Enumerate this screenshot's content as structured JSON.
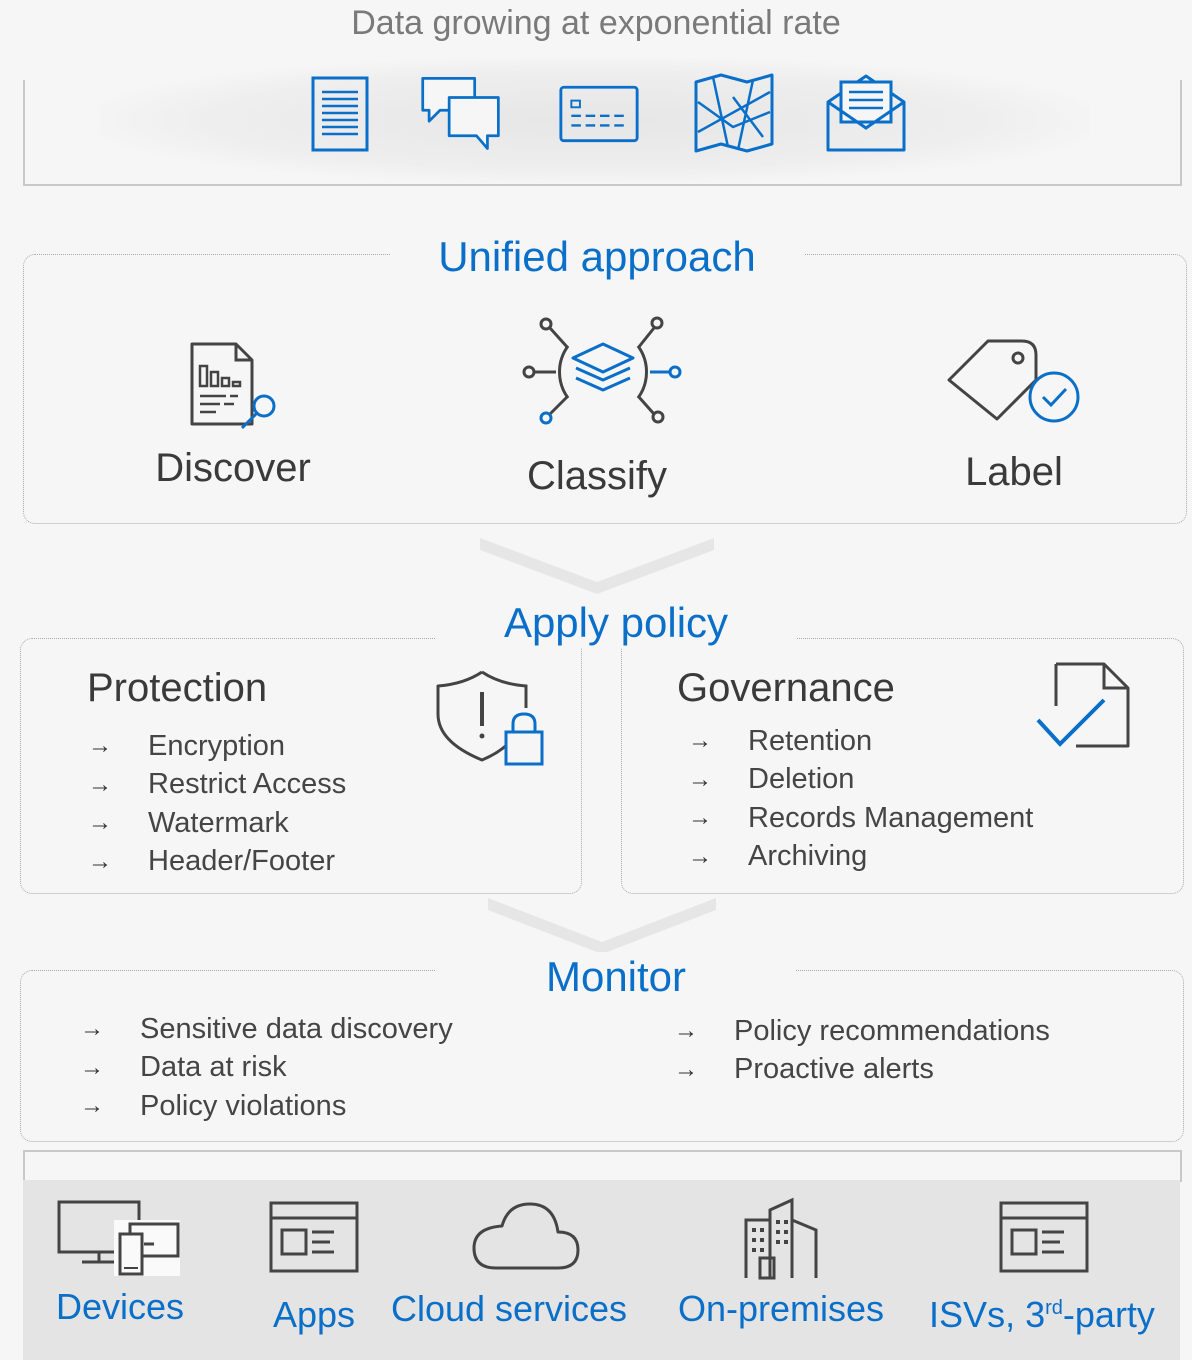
{
  "header": {
    "title": "Data growing at exponential rate",
    "icons": [
      "document-icon",
      "chat-icon",
      "card-icon",
      "map-icon",
      "email-icon"
    ]
  },
  "unified": {
    "title": "Unified approach",
    "steps": [
      {
        "label": "Discover",
        "icon": "document-search-icon"
      },
      {
        "label": "Classify",
        "icon": "classify-layers-icon"
      },
      {
        "label": "Label",
        "icon": "tag-check-icon"
      }
    ]
  },
  "apply_policy": {
    "title": "Apply policy",
    "protection": {
      "title": "Protection",
      "icon": "shield-lock-icon",
      "items": [
        "Encryption",
        "Restrict Access",
        "Watermark",
        "Header/Footer"
      ]
    },
    "governance": {
      "title": "Governance",
      "icon": "document-check-icon",
      "items": [
        "Retention",
        "Deletion",
        "Records Management",
        "Archiving"
      ]
    }
  },
  "monitor": {
    "title": "Monitor",
    "left_items": [
      "Sensitive data discovery",
      "Data at risk",
      "Policy violations"
    ],
    "right_items": [
      "Policy recommendations",
      "Proactive alerts"
    ]
  },
  "sources": {
    "items": [
      {
        "label": "Devices",
        "icon": "devices-icon"
      },
      {
        "label": "Apps",
        "icon": "app-window-icon"
      },
      {
        "label": "Cloud services",
        "icon": "cloud-icon"
      },
      {
        "label": "On-premises",
        "icon": "building-icon"
      },
      {
        "label_pre": "ISVs, 3",
        "label_sup": "rd",
        "label_post": "-party",
        "icon": "app-window-icon"
      }
    ]
  },
  "arrow_glyph": "→",
  "colors": {
    "accent": "#0a6fc9",
    "text": "#3c3c3c",
    "line": "#a9a9a9"
  }
}
